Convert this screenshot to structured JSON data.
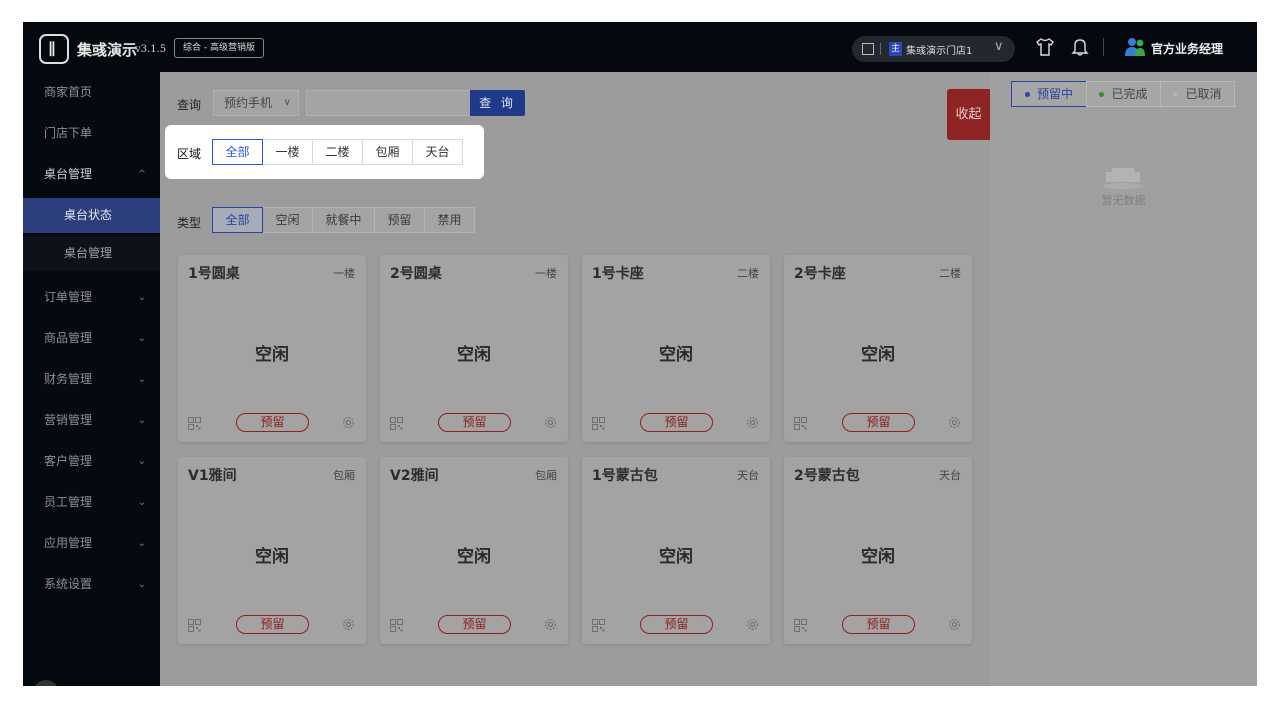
{
  "header": {
    "logo_glyph": "∥",
    "app_name": "集彧演示",
    "version": "v3.1.5",
    "edition": "综合 - 高级营销版",
    "store": {
      "tag": "主",
      "name": "集彧演示门店1"
    },
    "user_name": "官方业务经理"
  },
  "sidebar": {
    "items": [
      {
        "label": "商家首页",
        "has_children": false
      },
      {
        "label": "门店下单",
        "has_children": false
      },
      {
        "label": "桌台管理",
        "has_children": true,
        "expanded": true
      },
      {
        "label": "订单管理",
        "has_children": true
      },
      {
        "label": "商品管理",
        "has_children": true
      },
      {
        "label": "财务管理",
        "has_children": true
      },
      {
        "label": "营销管理",
        "has_children": true
      },
      {
        "label": "客户管理",
        "has_children": true
      },
      {
        "label": "员工管理",
        "has_children": true
      },
      {
        "label": "应用管理",
        "has_children": true
      },
      {
        "label": "系统设置",
        "has_children": true
      }
    ],
    "sub_items": [
      {
        "label": "桌台状态",
        "active": true
      },
      {
        "label": "桌台管理",
        "active": false
      }
    ]
  },
  "filters": {
    "query_label": "查询",
    "query_select": "预约手机",
    "search_value": "",
    "search_button": "查 询",
    "collapse_button": "收起",
    "region_label": "区域",
    "region_options": [
      "全部",
      "一楼",
      "二楼",
      "包厢",
      "天台"
    ],
    "region_selected": "全部",
    "type_label": "类型",
    "type_options": [
      "全部",
      "空闲",
      "就餐中",
      "预留",
      "禁用"
    ],
    "type_selected": "全部"
  },
  "tables": [
    {
      "name": "1号圆桌",
      "floor": "一楼",
      "status": "空闲",
      "action": "预留"
    },
    {
      "name": "2号圆桌",
      "floor": "一楼",
      "status": "空闲",
      "action": "预留"
    },
    {
      "name": "1号卡座",
      "floor": "二楼",
      "status": "空闲",
      "action": "预留"
    },
    {
      "name": "2号卡座",
      "floor": "二楼",
      "status": "空闲",
      "action": "预留"
    },
    {
      "name": "V1雅间",
      "floor": "包厢",
      "status": "空闲",
      "action": "预留"
    },
    {
      "name": "V2雅间",
      "floor": "包厢",
      "status": "空闲",
      "action": "预留"
    },
    {
      "name": "1号蒙古包",
      "floor": "天台",
      "status": "空闲",
      "action": "预留"
    },
    {
      "name": "2号蒙古包",
      "floor": "天台",
      "status": "空闲",
      "action": "预留"
    }
  ],
  "right_panel": {
    "tabs": [
      {
        "label": "预留中",
        "dot_color": "#2a44a3",
        "active": true
      },
      {
        "label": "已完成",
        "dot_color": "#3d8a2a",
        "active": false
      },
      {
        "label": "已取消",
        "dot_color": "#b5b5b5",
        "active": false
      }
    ],
    "empty_text": "暂无数据"
  },
  "colors": {
    "primary": "#2f54eb",
    "danger": "#c0392b",
    "sidebar_bg": "#050910",
    "topbar_bg": "#05080e"
  }
}
